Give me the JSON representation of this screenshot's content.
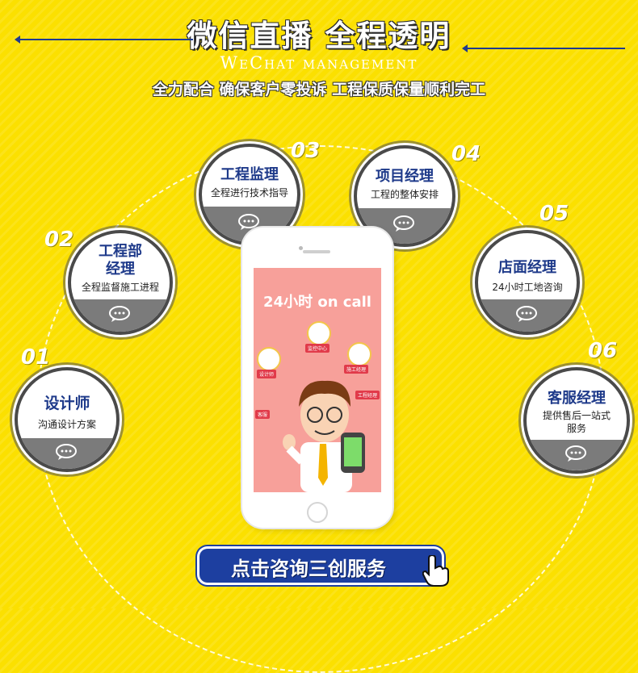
{
  "header": {
    "title": "微信直播  全程透明",
    "subtitle_en": "WeChat management",
    "tagline": "全力配合 确保客户零投诉 工程保质保量顺利完工"
  },
  "cards": [
    {
      "num": "01",
      "title": "设计师",
      "desc": "沟通设计方案"
    },
    {
      "num": "02",
      "title": "工程部\n经理",
      "title_line1": "工程部",
      "title_line2": "经理",
      "desc": "全程监督施工进程"
    },
    {
      "num": "03",
      "title": "工程监理",
      "desc": "全程进行技术指导"
    },
    {
      "num": "04",
      "title": "项目经理",
      "desc": "工程的整体安排"
    },
    {
      "num": "05",
      "title": "店面经理",
      "desc": "24小时工地咨询"
    },
    {
      "num": "06",
      "title": "客服经理",
      "desc_line1": "提供售后一站式",
      "desc_line2": "服务"
    }
  ],
  "phone": {
    "screen_title": "24小时 on call",
    "labels": [
      "监控中心",
      "施工经理",
      "设计师",
      "工程经理",
      "客服"
    ]
  },
  "cta": {
    "label": "点击咨询三创服务"
  },
  "colors": {
    "background": "#fbe000",
    "accent_blue": "#1e3a8a",
    "circle_band": "#7b7b7b",
    "screen_pink": "#f7a09a"
  },
  "icons": [
    "chat-bubble-icon",
    "hand-cursor-icon"
  ]
}
